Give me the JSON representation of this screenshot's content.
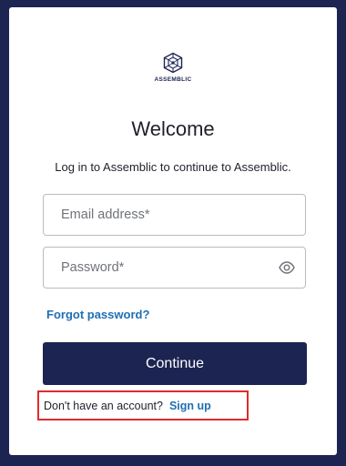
{
  "brand": {
    "name": "ASSEMBLIC",
    "logo_icon": "cube-network-icon"
  },
  "heading": {
    "title": "Welcome",
    "subtitle": "Log in to Assemblic to continue to Assemblic."
  },
  "form": {
    "email_placeholder": "Email address*",
    "email_value": "",
    "password_placeholder": "Password*",
    "password_value": "",
    "toggle_visibility_icon": "eye-icon",
    "forgot_password": "Forgot password?",
    "continue_label": "Continue"
  },
  "signup": {
    "prompt": "Don't have an account?",
    "link": "Sign up"
  },
  "colors": {
    "background": "#1c2452",
    "primary_button": "#1c2452",
    "link": "#1f6fb3",
    "highlight_box": "#e02b2b"
  }
}
